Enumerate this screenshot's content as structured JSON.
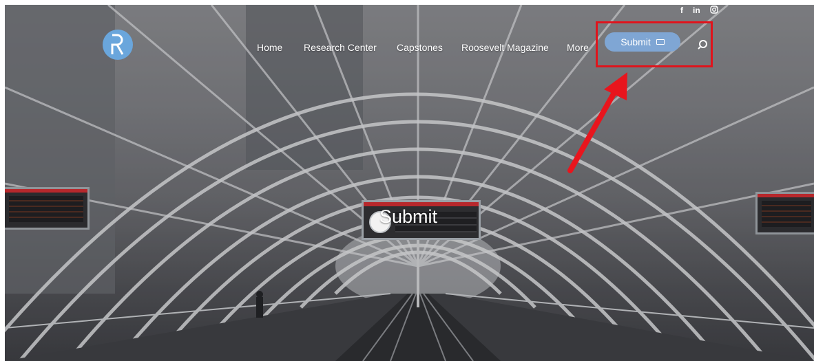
{
  "nav": {
    "items": [
      "Home",
      "Research Center",
      "Capstones",
      "Roosevelt Magazine",
      "More"
    ],
    "submit_label": "Submit"
  },
  "hero": {
    "title": "Submit"
  },
  "icons": {
    "social": [
      "facebook-icon",
      "linkedin-icon",
      "instagram-icon"
    ],
    "logo": "roosevelt-r-logo",
    "search": "search-icon",
    "submit": "keyboard-icon"
  },
  "social_labels": {
    "facebook": "f",
    "linkedin": "in"
  },
  "colors": {
    "submit_button": "#7fa6d4",
    "logo": "#6aa6dc",
    "annotation": "#e0141c"
  }
}
